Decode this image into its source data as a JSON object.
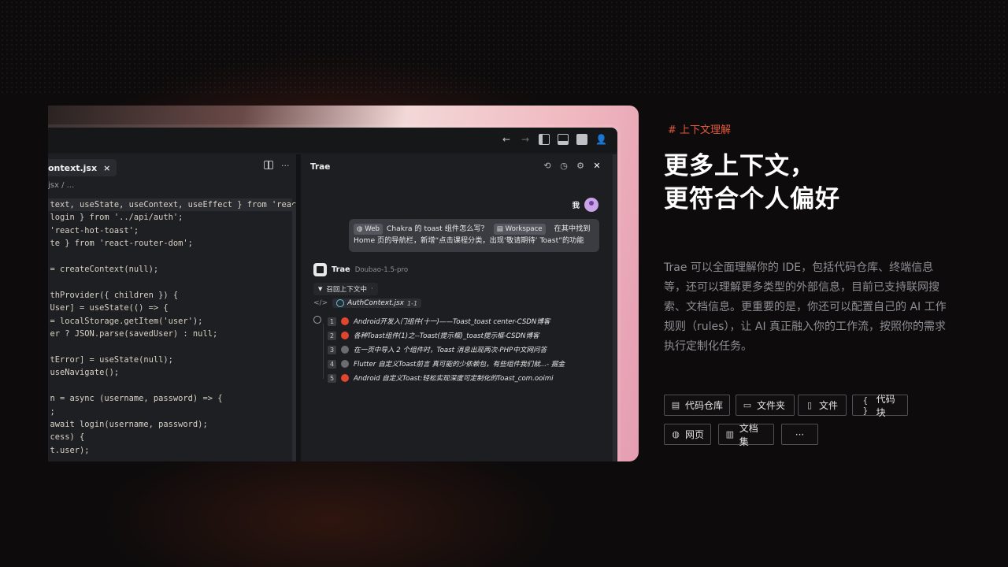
{
  "ide": {
    "tab_label": "ontext.jsx",
    "tab_close": "×",
    "breadcrumb": "jsx / ...",
    "code_lines": [
      "  text, useState, useContext, useEffect } from 'react';",
      "  login } from '../api/auth';",
      "  'react-hot-toast';",
      "  te } from 'react-router-dom';",
      "",
      "  = createContext(null);",
      "",
      "  thProvider({ children }) {",
      "  User] = useState(() => {",
      "  = localStorage.getItem('user');",
      "  er ? JSON.parse(savedUser) : null;",
      "",
      "  tError] = useState(null);",
      "  useNavigate();",
      "",
      "  n = async (username, password) => {",
      "  ;",
      "  await login(username, password);",
      "  cess) {",
      "  t.user);"
    ]
  },
  "trae_panel": {
    "title": "Trae",
    "user_label": "我",
    "message": {
      "chip_web": "Web",
      "text_1": "Chakra 的 toast 组件怎么写？",
      "chip_workspace": "Workspace",
      "text_2": "在其中找到",
      "text_3": "Home 页的导航栏，新增“点击课程分类，出现‘敬请期待’ Toast”的功能"
    },
    "bot_name": "Trae",
    "bot_model": "Doubao-1.5-pro",
    "recall_label": "召回上下文中",
    "context_file": "AuthContext.jsx",
    "context_range": "1-1",
    "results": [
      {
        "num": "1",
        "favicon": "red",
        "title": "Android开发入门组件(十一)——Toast_toast center-CSDN博客"
      },
      {
        "num": "2",
        "favicon": "red",
        "title": "各种Toast组件(1)之--Toast(提示框)_toast提示框-CSDN博客"
      },
      {
        "num": "3",
        "favicon": "gray",
        "title": "在一页中导入 2 个组件时，Toast 消息出现两次-PHP中文网问答"
      },
      {
        "num": "4",
        "favicon": "gray",
        "title": "Flutter 自定义Toast前言 真可能的少依赖包，有些组件我们就...- 掘金"
      },
      {
        "num": "5",
        "favicon": "red",
        "title": "Android 自定义Toast:轻松实现深度可定制化的Toast_com.ooimi"
      }
    ]
  },
  "right": {
    "tag": "# 上下文理解",
    "headline_1": "更多上下文，",
    "headline_2": "更符合个人偏好",
    "description": "Trae 可以全面理解你的 IDE，包括代码仓库、终端信息等，还可以理解更多类型的外部信息，目前已支持联网搜索、文档信息。更重要的是，你还可以配置自己的 AI 工作规则（rules），让 AI 真正融入你的工作流，按照你的需求执行定制化任务。",
    "buttons": [
      {
        "icon": "repo-icon",
        "label": "代码仓库"
      },
      {
        "icon": "folder-icon",
        "label": "文件夹"
      },
      {
        "icon": "file-icon",
        "label": "文件"
      },
      {
        "icon": "braces-icon",
        "label": "代码块"
      },
      {
        "icon": "globe-icon",
        "label": "网页"
      },
      {
        "icon": "book-icon",
        "label": "文档集"
      },
      {
        "icon": "more-icon",
        "label": "···"
      }
    ]
  },
  "colors": {
    "accent": "#e45a3c",
    "background": "#0d0b0c"
  }
}
